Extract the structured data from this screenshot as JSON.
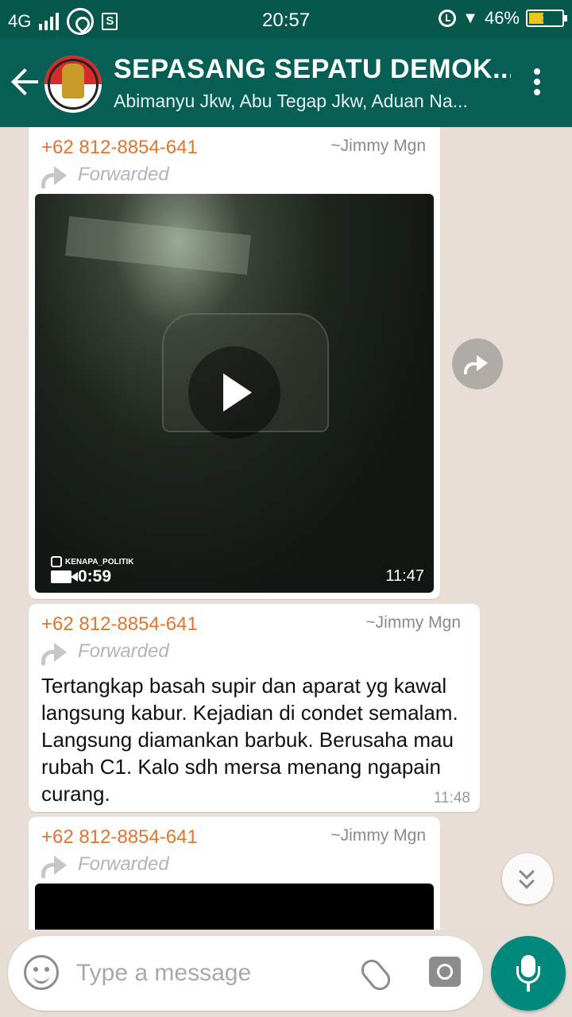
{
  "status_bar": {
    "network": "4G",
    "time": "20:57",
    "battery": "46%",
    "battery_level": 0.46
  },
  "header": {
    "title": "SEPASANG SEPATU DEMOK...",
    "members": "Abimanyu Jkw, Abu Tegap Jkw, Aduan Na..."
  },
  "messages": [
    {
      "sender": "+62 812-8854-641",
      "alias": "~Jimmy Mgn",
      "forwarded": "Forwarded",
      "type": "video",
      "watermark": "KENAPA_POLITIK",
      "duration": "0:59",
      "time": "11:47"
    },
    {
      "sender": "+62 812-8854-641",
      "alias": "~Jimmy Mgn",
      "forwarded": "Forwarded",
      "type": "text",
      "text": "Tertangkap basah supir dan aparat yg kawal langsung kabur. Kejadian di condet semalam. Langsung diamankan barbuk. Berusaha mau rubah C1. Kalo sdh mersa menang ngapain curang.",
      "time": "11:48"
    },
    {
      "sender": "+62 812-8854-641",
      "alias": "~Jimmy Mgn",
      "forwarded": "Forwarded",
      "type": "video"
    }
  ],
  "input": {
    "placeholder": "Type a message"
  },
  "icons": {
    "back": "arrow-left-icon",
    "menu": "more-vert-icon",
    "forward": "forward-icon",
    "emoji": "smiley-icon",
    "attach": "paperclip-icon",
    "camera": "camera-icon",
    "mic": "mic-icon",
    "scroll": "double-chevron-down-icon"
  },
  "colors": {
    "header": "#075e54",
    "status_bar": "#06584d",
    "sender": "#e3742d",
    "accent": "#00897b"
  }
}
